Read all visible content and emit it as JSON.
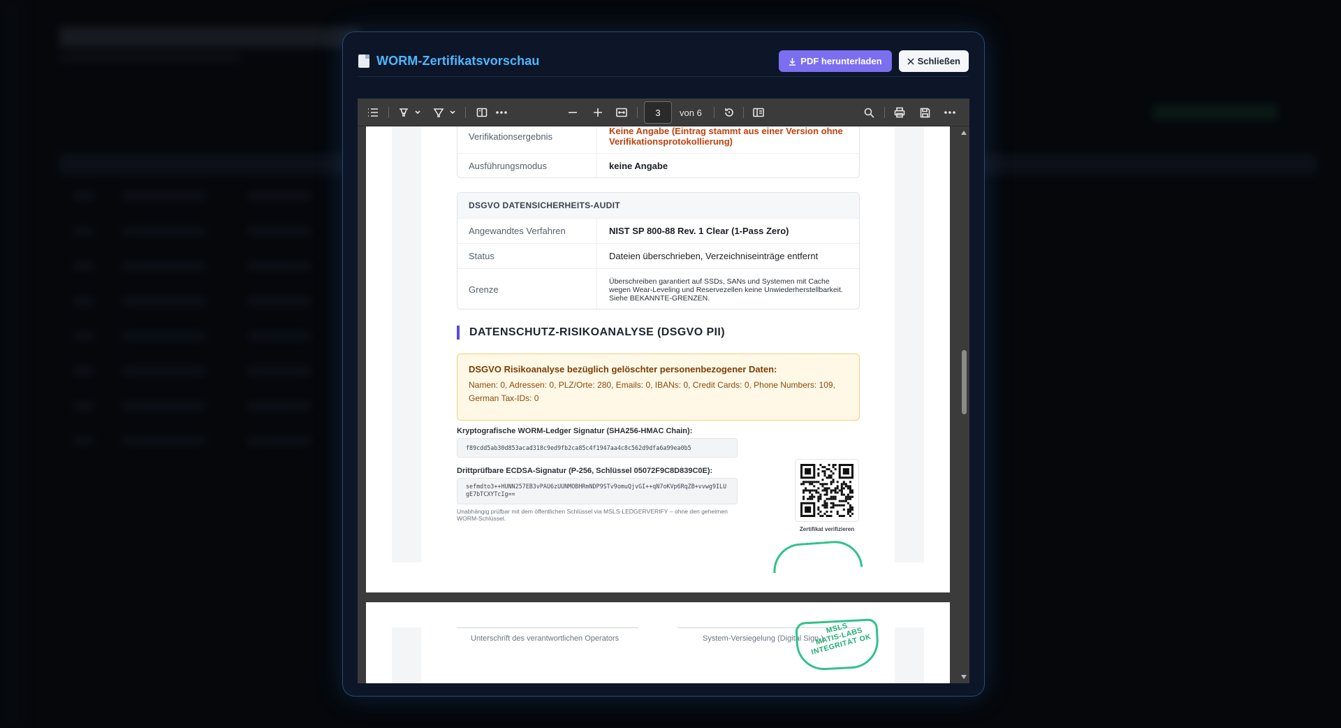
{
  "modal": {
    "title": "WORM-Zertifikatsvorschau",
    "download_label": "PDF herunterladen",
    "close_label": "Schließen"
  },
  "viewer": {
    "page_current": "3",
    "page_of": "von 6"
  },
  "exec_table": {
    "rows": [
      {
        "label": "Verifikationsergebnis",
        "value": "Keine Angabe (Eintrag stammt aus einer Version ohne Verifikationsprotokollierung)"
      },
      {
        "label": "Ausführungsmodus",
        "value": "keine Angabe"
      }
    ]
  },
  "audit": {
    "heading": "DSGVO DATENSICHERHEITS-AUDIT",
    "rows": [
      {
        "label": "Angewandtes Verfahren",
        "value": "NIST SP 800-88 Rev. 1 Clear (1-Pass Zero)"
      },
      {
        "label": "Status",
        "value": "Dateien überschrieben, Verzeichniseinträge entfernt"
      },
      {
        "label": "Grenze",
        "value": "Überschreiben garantiert auf SSDs, SANs und Systemen mit Cache wegen Wear-Leveling und Reservezellen keine Unwiederherstellbarkeit. Siehe BEKANNTE-GRENZEN."
      }
    ]
  },
  "risk": {
    "section_title": "DATENSCHUTZ-RISIKOANALYSE (DSGVO PII)",
    "box_title": "DSGVO Risikoanalyse bezüglich gelöschter personenbezogener Daten:",
    "box_text": "Namen: 0, Adressen: 0, PLZ/Orte: 280, Emails: 0, IBANs: 0, Credit Cards: 0, Phone Numbers: 109, German Tax-IDs: 0"
  },
  "signatures": {
    "ledger_label": "Kryptografische WORM-Ledger Signatur (SHA256-HMAC Chain):",
    "ledger_hash": "f89cdd5ab30d853acad318c9ed9fb2ca85c4f1947aa4c8c562d9dfa6a99ea0b5",
    "ecdsa_label": "Drittprüfbare ECDSA-Signatur (P-256, Schlüssel 05072F9C8D839C0E):",
    "ecdsa_sig": "sefmdto3++HUNN257EB3vPAU6zUUNMOBHRmNDP9STv9omuQjvGI++qN7oKVp6RqZB+vvwg9ILUgE7bTCXYTcIg==",
    "note": "Unabhängig prüfbar mit dem öffentlichen Schlüssel via MSLS-LEDGERVERIFY – ohne den geheimen WORM-Schlüssel.",
    "qr_caption": "Zertifikat verifizieren"
  },
  "footer": {
    "operator_caption": "Unterschrift des verantwortlichen Operators",
    "seal_caption": "System-Versiegelung (Digital Sign.)",
    "stamp_lines": [
      "MSLS",
      "MATIS-LABS",
      "INTEGRITÄT OK"
    ]
  },
  "colors": {
    "accent": "#4fb6ff",
    "download_button": "#7b6ff0",
    "warning": "#c2410c",
    "stamp": "#2fc28a"
  }
}
